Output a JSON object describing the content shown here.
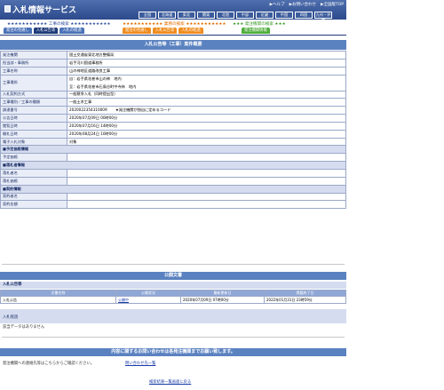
{
  "header": {
    "title": "入札情報サービス",
    "links": [
      "▶ヘルプ",
      "▶お問い合わせ",
      "▶全国版TOP"
    ],
    "regions": [
      "全国",
      "北海道",
      "東北",
      "関東",
      "北陸",
      "中部",
      "近畿",
      "中国",
      "四国",
      "九州・沖縄"
    ]
  },
  "categories": {
    "construction": "★★★★★★★★★★★ 工事の検索 ★★★★★★★★★★★",
    "service": "★★★★★★★★★★★ 業務の検索 ★★★★★★★★★★★",
    "orderer": "★★★ 発注機関の検索 ★★★"
  },
  "tabs": {
    "construction": [
      "発注の見通し",
      "入札公告等",
      "入札の経過"
    ],
    "service": [
      "発注の見通し",
      "入札公告等",
      "入札の経過"
    ],
    "orderer": [
      "発注機関情報"
    ]
  },
  "page_title": "入札公告等（工事）案件概要",
  "details": [
    {
      "k": "発注機関",
      "v": "国土交通省東北地方整備局"
    },
    {
      "k": "担当部・事務所",
      "v": "岩手河川国道事務所"
    },
    {
      "k": "工事名称",
      "v": "山の神地区道路改良工事"
    },
    {
      "k": "工事場所",
      "v": "自：岩手県花巻市山の神　地内",
      "v2": "至：岩手県花巻市石鳥谷町中寺林　地内"
    },
    {
      "k": "入札契約方式",
      "v": "一般競争入札（同時提出型）"
    },
    {
      "k": "工事種別／工事の種類",
      "v": "一般土木工事"
    },
    {
      "k": "調達番号",
      "v": "2020022354310009",
      "v2": "★発注機関が独自に定めるコード"
    },
    {
      "k": "公告日時",
      "v": "2020年07月09日 00時00分"
    },
    {
      "k": "閲覧日時",
      "v": "2020年07月16日 14時00分"
    },
    {
      "k": "開札日時",
      "v": "2020年08月24日 10時00分"
    },
    {
      "k": "電子入札対象",
      "v": "対象"
    }
  ],
  "sections": {
    "estimate": {
      "title": "■予定価格情報",
      "rows": [
        "予定価格"
      ]
    },
    "winner": {
      "title": "■落札者情報",
      "rows": [
        "落札者名",
        "落札価格"
      ]
    },
    "contract": {
      "title": "■契約情報",
      "rows": [
        "契約者名",
        "契約金額"
      ]
    }
  },
  "public_docs": {
    "title": "公開文書",
    "bid_notice_label": "入札公告等",
    "columns": [
      "文書名称",
      "公開状況",
      "最新更新日",
      "掲載終了日"
    ],
    "rows": [
      {
        "name": "入札公告",
        "status": "公開中",
        "updated": "2020年07月09日 07時00分",
        "end": "2022年01月31日 23時59分"
      }
    ],
    "history_label": "入札経過",
    "no_data": "該当データはありません"
  },
  "contact": {
    "title": "内容に関するお問い合わせは各発注機関までお願い致します。",
    "text": "発注機関への連絡先等はこちらからご確認ください。",
    "link": "問い合わせ先一覧"
  },
  "back_link": "検索結果一覧画面に戻る"
}
